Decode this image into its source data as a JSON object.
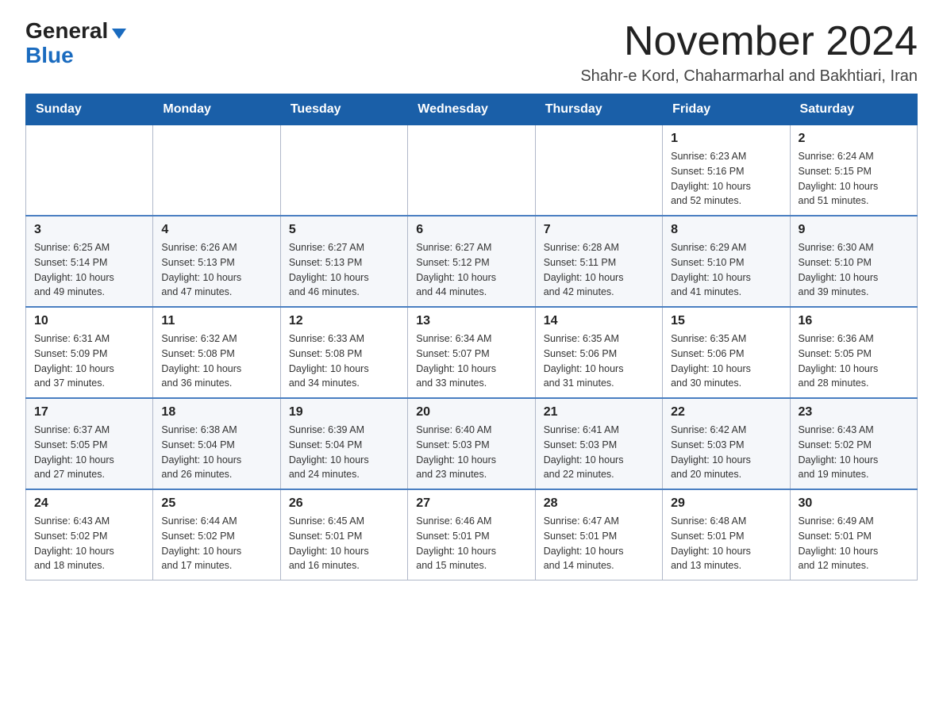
{
  "header": {
    "logo": {
      "general": "General",
      "blue": "Blue",
      "arrow": "▲"
    },
    "title": "November 2024",
    "location": "Shahr-e Kord, Chaharmarhal and Bakhtiari, Iran"
  },
  "weekdays": [
    "Sunday",
    "Monday",
    "Tuesday",
    "Wednesday",
    "Thursday",
    "Friday",
    "Saturday"
  ],
  "weeks": [
    [
      {
        "day": "",
        "info": ""
      },
      {
        "day": "",
        "info": ""
      },
      {
        "day": "",
        "info": ""
      },
      {
        "day": "",
        "info": ""
      },
      {
        "day": "",
        "info": ""
      },
      {
        "day": "1",
        "info": "Sunrise: 6:23 AM\nSunset: 5:16 PM\nDaylight: 10 hours\nand 52 minutes."
      },
      {
        "day": "2",
        "info": "Sunrise: 6:24 AM\nSunset: 5:15 PM\nDaylight: 10 hours\nand 51 minutes."
      }
    ],
    [
      {
        "day": "3",
        "info": "Sunrise: 6:25 AM\nSunset: 5:14 PM\nDaylight: 10 hours\nand 49 minutes."
      },
      {
        "day": "4",
        "info": "Sunrise: 6:26 AM\nSunset: 5:13 PM\nDaylight: 10 hours\nand 47 minutes."
      },
      {
        "day": "5",
        "info": "Sunrise: 6:27 AM\nSunset: 5:13 PM\nDaylight: 10 hours\nand 46 minutes."
      },
      {
        "day": "6",
        "info": "Sunrise: 6:27 AM\nSunset: 5:12 PM\nDaylight: 10 hours\nand 44 minutes."
      },
      {
        "day": "7",
        "info": "Sunrise: 6:28 AM\nSunset: 5:11 PM\nDaylight: 10 hours\nand 42 minutes."
      },
      {
        "day": "8",
        "info": "Sunrise: 6:29 AM\nSunset: 5:10 PM\nDaylight: 10 hours\nand 41 minutes."
      },
      {
        "day": "9",
        "info": "Sunrise: 6:30 AM\nSunset: 5:10 PM\nDaylight: 10 hours\nand 39 minutes."
      }
    ],
    [
      {
        "day": "10",
        "info": "Sunrise: 6:31 AM\nSunset: 5:09 PM\nDaylight: 10 hours\nand 37 minutes."
      },
      {
        "day": "11",
        "info": "Sunrise: 6:32 AM\nSunset: 5:08 PM\nDaylight: 10 hours\nand 36 minutes."
      },
      {
        "day": "12",
        "info": "Sunrise: 6:33 AM\nSunset: 5:08 PM\nDaylight: 10 hours\nand 34 minutes."
      },
      {
        "day": "13",
        "info": "Sunrise: 6:34 AM\nSunset: 5:07 PM\nDaylight: 10 hours\nand 33 minutes."
      },
      {
        "day": "14",
        "info": "Sunrise: 6:35 AM\nSunset: 5:06 PM\nDaylight: 10 hours\nand 31 minutes."
      },
      {
        "day": "15",
        "info": "Sunrise: 6:35 AM\nSunset: 5:06 PM\nDaylight: 10 hours\nand 30 minutes."
      },
      {
        "day": "16",
        "info": "Sunrise: 6:36 AM\nSunset: 5:05 PM\nDaylight: 10 hours\nand 28 minutes."
      }
    ],
    [
      {
        "day": "17",
        "info": "Sunrise: 6:37 AM\nSunset: 5:05 PM\nDaylight: 10 hours\nand 27 minutes."
      },
      {
        "day": "18",
        "info": "Sunrise: 6:38 AM\nSunset: 5:04 PM\nDaylight: 10 hours\nand 26 minutes."
      },
      {
        "day": "19",
        "info": "Sunrise: 6:39 AM\nSunset: 5:04 PM\nDaylight: 10 hours\nand 24 minutes."
      },
      {
        "day": "20",
        "info": "Sunrise: 6:40 AM\nSunset: 5:03 PM\nDaylight: 10 hours\nand 23 minutes."
      },
      {
        "day": "21",
        "info": "Sunrise: 6:41 AM\nSunset: 5:03 PM\nDaylight: 10 hours\nand 22 minutes."
      },
      {
        "day": "22",
        "info": "Sunrise: 6:42 AM\nSunset: 5:03 PM\nDaylight: 10 hours\nand 20 minutes."
      },
      {
        "day": "23",
        "info": "Sunrise: 6:43 AM\nSunset: 5:02 PM\nDaylight: 10 hours\nand 19 minutes."
      }
    ],
    [
      {
        "day": "24",
        "info": "Sunrise: 6:43 AM\nSunset: 5:02 PM\nDaylight: 10 hours\nand 18 minutes."
      },
      {
        "day": "25",
        "info": "Sunrise: 6:44 AM\nSunset: 5:02 PM\nDaylight: 10 hours\nand 17 minutes."
      },
      {
        "day": "26",
        "info": "Sunrise: 6:45 AM\nSunset: 5:01 PM\nDaylight: 10 hours\nand 16 minutes."
      },
      {
        "day": "27",
        "info": "Sunrise: 6:46 AM\nSunset: 5:01 PM\nDaylight: 10 hours\nand 15 minutes."
      },
      {
        "day": "28",
        "info": "Sunrise: 6:47 AM\nSunset: 5:01 PM\nDaylight: 10 hours\nand 14 minutes."
      },
      {
        "day": "29",
        "info": "Sunrise: 6:48 AM\nSunset: 5:01 PM\nDaylight: 10 hours\nand 13 minutes."
      },
      {
        "day": "30",
        "info": "Sunrise: 6:49 AM\nSunset: 5:01 PM\nDaylight: 10 hours\nand 12 minutes."
      }
    ]
  ]
}
